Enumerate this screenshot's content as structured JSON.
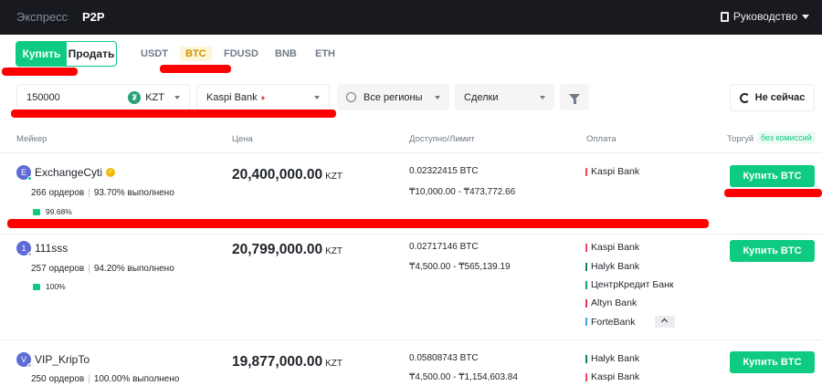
{
  "topbar": {
    "express_label": "Экспресс",
    "p2p_label": "P2P",
    "guide_label": "Руководство"
  },
  "trade_toggle": {
    "buy_label": "Купить",
    "sell_label": "Продать"
  },
  "assets": [
    "USDT",
    "BTC",
    "FDUSD",
    "BNB",
    "ETH"
  ],
  "active_asset": "BTC",
  "filters": {
    "amount_value": "150000",
    "currency": "KZT",
    "payment": "Kaspi Bank",
    "regions": "Все регионы",
    "trades": "Сделки",
    "refresh_label": "Не сейчас"
  },
  "table_headers": {
    "maker": "Мейкер",
    "price": "Цена",
    "available": "Доступно/Лимит",
    "payment": "Оплата",
    "trade": "Торгуй",
    "no_fee": "без комиссий"
  },
  "rows": [
    {
      "initial": "E",
      "name": "ExchangeCyti",
      "orders": "266 ордеров",
      "completion": "93.70% выполнено",
      "rating": "99.68%",
      "price": "20,400,000.00",
      "currency": "KZT",
      "available": "0.02322415 BTC",
      "limit": "₸10,000.00 - ₸473,772.66",
      "payments": [
        "Kaspi Bank"
      ],
      "buy_label": "Купить BTC"
    },
    {
      "initial": "1",
      "name": "111sss",
      "orders": "257 ордеров",
      "completion": "94.20% выполнено",
      "rating": "100%",
      "price": "20,799,000.00",
      "currency": "KZT",
      "available": "0.02717146 BTC",
      "limit": "₸4,500.00 - ₸565,139.19",
      "payments": [
        "Kaspi Bank",
        "Halyk Bank",
        "ЦентрКредит Банк",
        "Altyn Bank",
        "ForteBank"
      ],
      "buy_label": "Купить BTC"
    },
    {
      "initial": "V",
      "name": "VIP_KripTo",
      "orders": "250 ордеров",
      "completion": "100.00% выполнено",
      "price": "19,877,000.00",
      "currency": "KZT",
      "available": "0.05808743 BTC",
      "limit": "₸4,500.00 - ₸1,154,603.84",
      "payments": [
        "Halyk Bank",
        "Kaspi Bank"
      ],
      "buy_label": "Купить BTC"
    }
  ],
  "colors": {
    "brand_green": "#0ecb81",
    "kaspi": "#f6465d",
    "halyk": "#0a8a4a",
    "centrkredit": "#0e9f6e",
    "altyn": "#e8314b",
    "forte": "#35a6e8",
    "annotation_red": "#ff0000"
  }
}
